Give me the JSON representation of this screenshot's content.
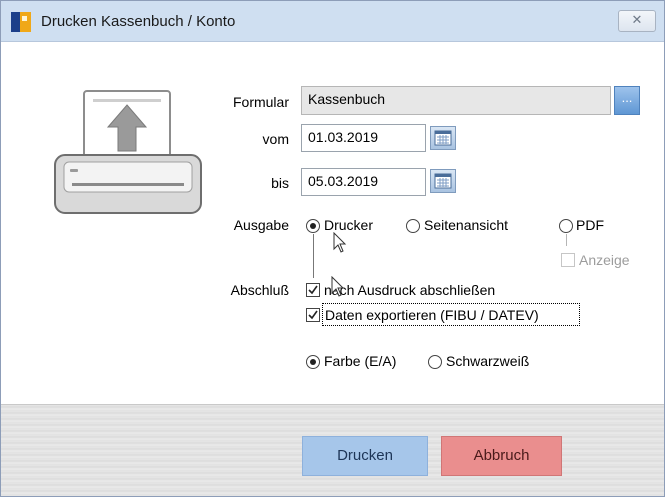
{
  "window": {
    "title": "Drucken Kassenbuch / Konto",
    "close_icon": "close-icon"
  },
  "form": {
    "formular_label": "Formular",
    "formular_value": "Kassenbuch",
    "formular_button": "...",
    "vom_label": "vom",
    "vom_value": "01.03.2019",
    "bis_label": "bis",
    "bis_value": "05.03.2019"
  },
  "ausgabe": {
    "label": "Ausgabe",
    "options": [
      {
        "label": "Drucker",
        "selected": true
      },
      {
        "label": "Seitenansicht",
        "selected": false
      },
      {
        "label": "PDF",
        "selected": false
      }
    ],
    "anzeige_label": "Anzeige",
    "anzeige_checked": false,
    "anzeige_enabled": false
  },
  "abschluss": {
    "label": "Abschluß",
    "options": [
      {
        "label": "nach Ausdruck abschließen",
        "checked": true
      },
      {
        "label": "Daten exportieren (FIBU / DATEV)",
        "checked": true
      }
    ]
  },
  "farbe": {
    "options": [
      {
        "label": "Farbe (E/A)",
        "selected": true
      },
      {
        "label": "Schwarzweiß",
        "selected": false
      }
    ]
  },
  "buttons": {
    "print": "Drucken",
    "cancel": "Abbruch"
  }
}
